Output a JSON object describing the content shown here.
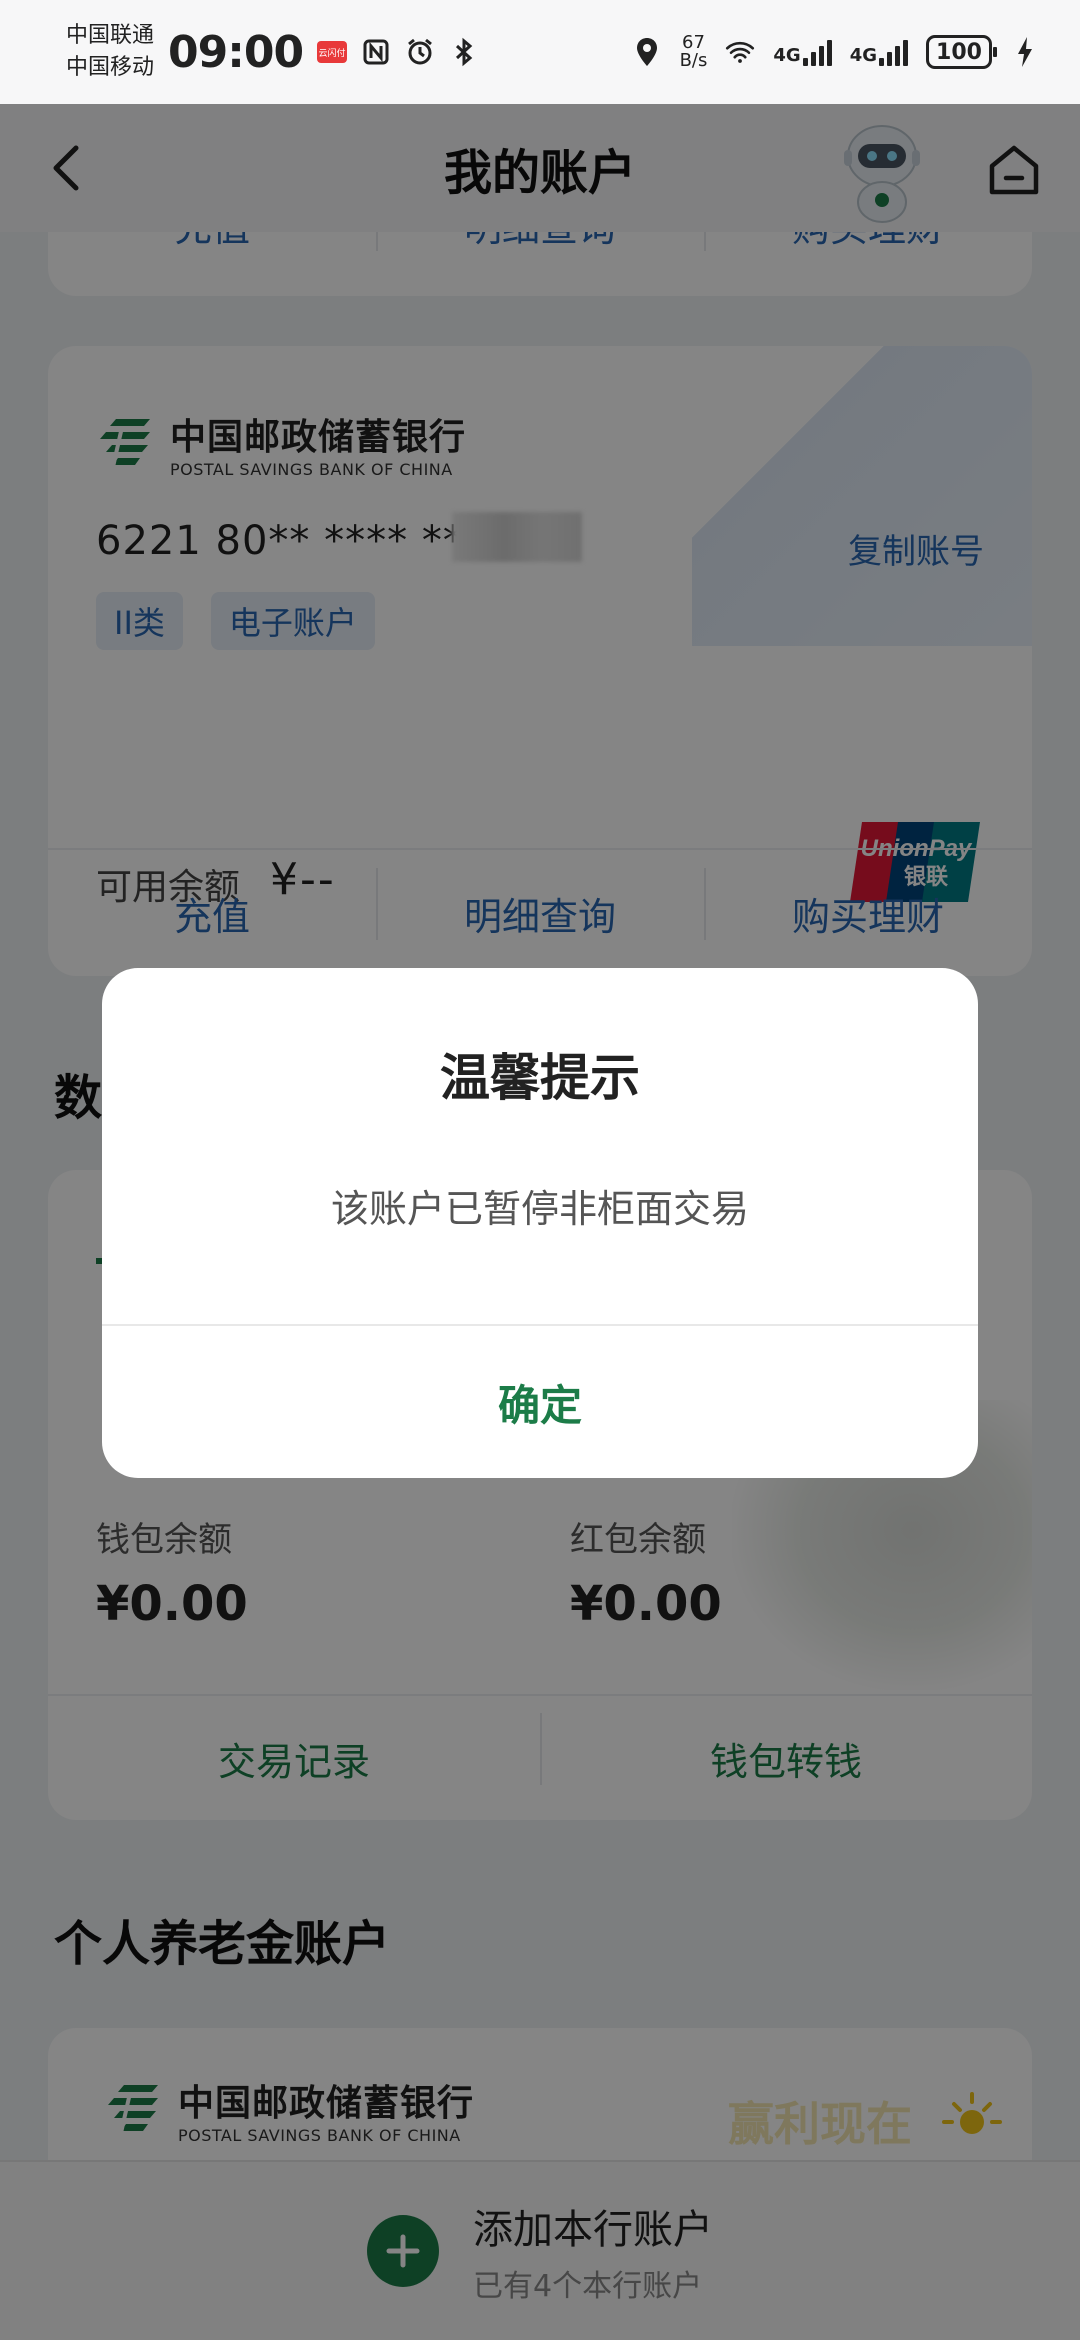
{
  "status_bar": {
    "carrier1": "中国联通",
    "carrier2": "中国移动",
    "time": "09:00",
    "pay_badge": "云闪付",
    "speed": "67",
    "speed_unit": "B/s",
    "net1": "4G",
    "net2": "4G",
    "battery": "100"
  },
  "header": {
    "title": "我的账户"
  },
  "top_stub_actions": [
    "充值",
    "明细查询",
    "购买理财"
  ],
  "bank_card": {
    "bank_name_cn": "中国邮政储蓄银行",
    "bank_name_en": "POSTAL SAVINGS BANK OF CHINA",
    "account_number": "6221 80** **** ***",
    "copy_label": "复制账号",
    "tags": [
      "II类",
      "电子账户"
    ],
    "balance_label": "可用余额",
    "balance_value": "¥--",
    "actions": [
      "充值",
      "明细查询",
      "购买理财"
    ]
  },
  "wallet_section": {
    "title_partial": "数",
    "wallet_balance_label": "钱包余额",
    "wallet_balance": "¥0.00",
    "red_packet_label": "红包余额",
    "red_packet_balance": "¥0.00",
    "actions": [
      "交易记录",
      "钱包转钱"
    ]
  },
  "pension_section": {
    "title": "个人养老金账户",
    "bank_name_cn": "中国邮政储蓄银行",
    "bank_name_en": "POSTAL SAVINGS BANK OF CHINA",
    "slogan": "赢利现在"
  },
  "bottom_bar": {
    "add_label": "添加本行账户",
    "sub_label": "已有4个本行账户"
  },
  "dialog": {
    "title": "温馨提示",
    "message": "该账户已暂停非柜面交易",
    "confirm": "确定"
  },
  "colors": {
    "accent_green": "#1c7c48",
    "link_blue": "#2a67b1"
  }
}
